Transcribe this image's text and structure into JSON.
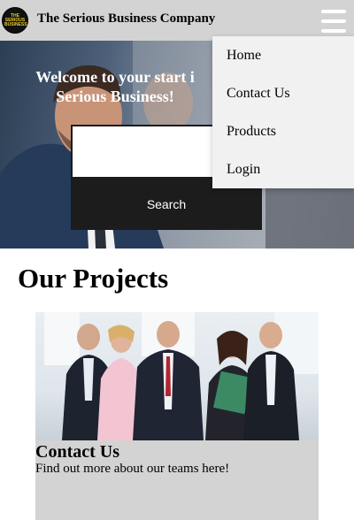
{
  "header": {
    "brand": "The Serious Business Company",
    "logo_text": "THE SERIOUS BUSINESS"
  },
  "hero": {
    "title": "Welcome to your start i\nSerious Business!",
    "search_value": "",
    "search_button": "Search"
  },
  "menu": {
    "items": [
      {
        "label": "Home"
      },
      {
        "label": "Contact Us"
      },
      {
        "label": "Products"
      },
      {
        "label": "Login"
      }
    ]
  },
  "projects": {
    "title": "Our Projects",
    "cards": [
      {
        "title": "Contact Us",
        "text": "Find out more about our teams here!"
      }
    ]
  },
  "colors": {
    "header_bg": "#d3d3d3",
    "button_bg": "#1c1c1c",
    "card_bg": "#d3d3d3",
    "menu_bg": "#f1f1f1"
  }
}
